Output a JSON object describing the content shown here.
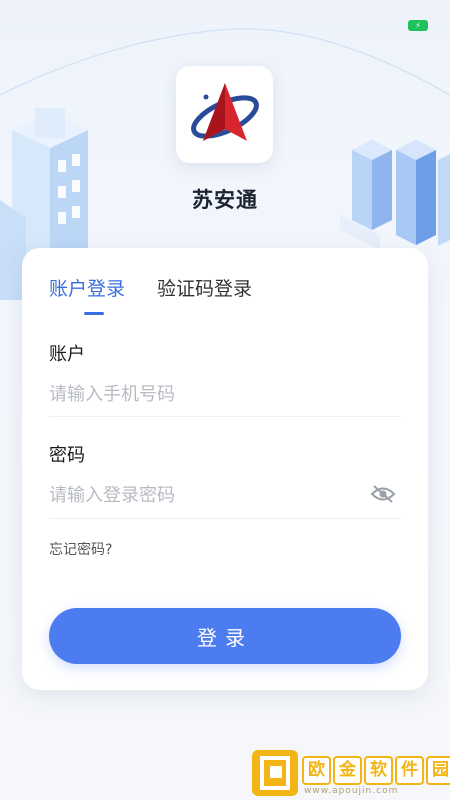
{
  "app": {
    "name": "苏安通"
  },
  "tabs": [
    {
      "label": "账户登录",
      "active": true
    },
    {
      "label": "验证码登录",
      "active": false
    }
  ],
  "form": {
    "account_label": "账户",
    "account_placeholder": "请输入手机号码",
    "account_value": "",
    "password_label": "密码",
    "password_placeholder": "请输入登录密码",
    "password_value": "",
    "forgot_label": "忘记密码?",
    "submit_label": "登录"
  },
  "watermark": {
    "title": [
      "欧",
      "金",
      "软",
      "件",
      "园"
    ],
    "url": "www.apoujin.com"
  },
  "icons": {
    "battery": "battery-icon",
    "password_visibility": "eye-off-icon"
  },
  "colors": {
    "accent": "#3a6ee0",
    "button": "#4d7cf0",
    "watermark": "#f3b515",
    "battery": "#1ec25a"
  }
}
